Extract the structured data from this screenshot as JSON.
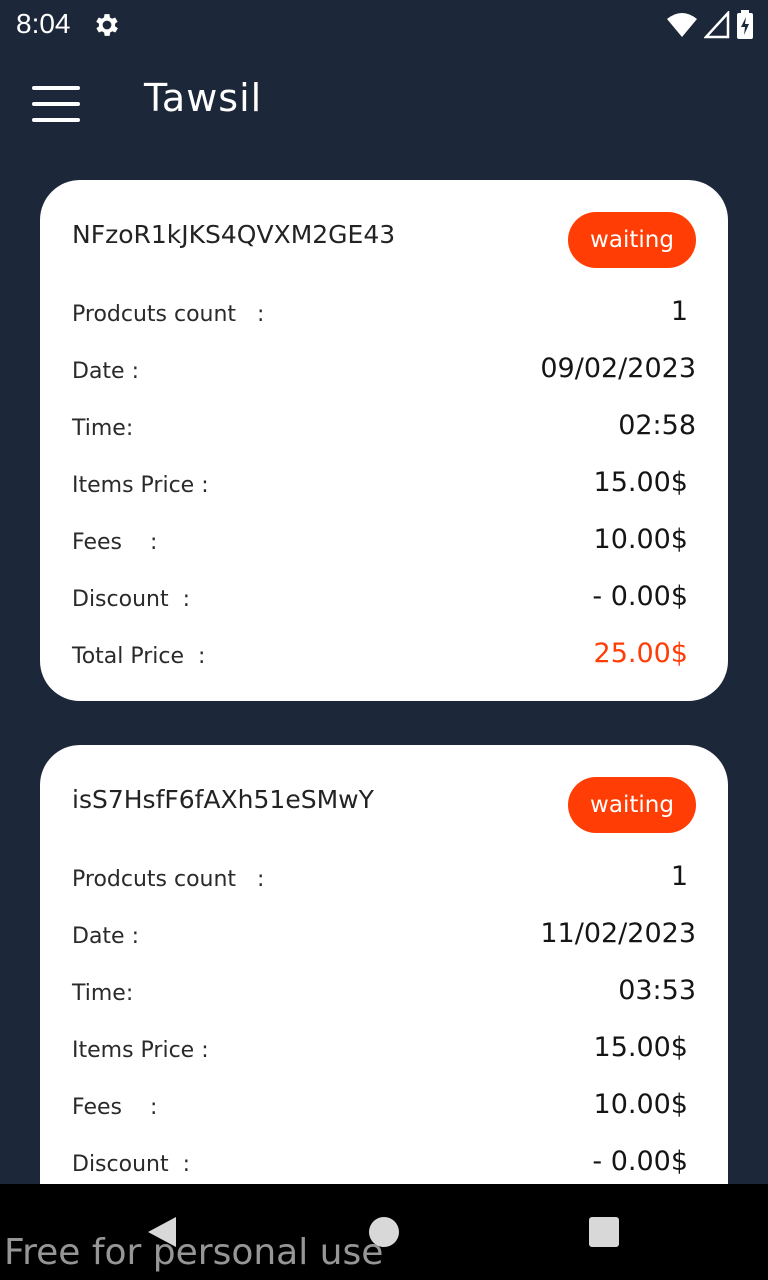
{
  "status_bar": {
    "time": "8:04",
    "icons": [
      "gear-icon",
      "wifi-icon",
      "signal-icon",
      "battery-charging-icon"
    ]
  },
  "app_bar": {
    "title": "Tawsil",
    "menu_icon": "hamburger-menu-icon"
  },
  "colors": {
    "background": "#1c2839",
    "card": "#ffffff",
    "accent": "#ff3d05"
  },
  "orders": [
    {
      "id": "NFzoR1kJKS4QVXM2GE43",
      "status": "waiting",
      "rows": [
        {
          "label": "Prodcuts count   :",
          "value": "1"
        },
        {
          "label": "Date :",
          "value": "09/02/2023"
        },
        {
          "label": "Time:",
          "value": "02:58"
        },
        {
          "label": "Items Price :",
          "value": "15.00$"
        },
        {
          "label": "Fees    :",
          "value": "10.00$"
        },
        {
          "label": "Discount  :",
          "value": "- 0.00$"
        },
        {
          "label": "Total Price  :",
          "value": "25.00$"
        }
      ]
    },
    {
      "id": "isS7HsfF6fAXh51eSMwY",
      "status": "waiting",
      "rows": [
        {
          "label": "Prodcuts count   :",
          "value": "1"
        },
        {
          "label": "Date :",
          "value": "11/02/2023"
        },
        {
          "label": "Time:",
          "value": "03:53"
        },
        {
          "label": "Items Price :",
          "value": "15.00$"
        },
        {
          "label": "Fees    :",
          "value": "10.00$"
        },
        {
          "label": "Discount  :",
          "value": "- 0.00$"
        }
      ]
    }
  ],
  "nav_bar": {
    "icons": [
      "back-icon",
      "home-icon",
      "recent-apps-icon"
    ]
  },
  "watermark": "Free for personal use"
}
